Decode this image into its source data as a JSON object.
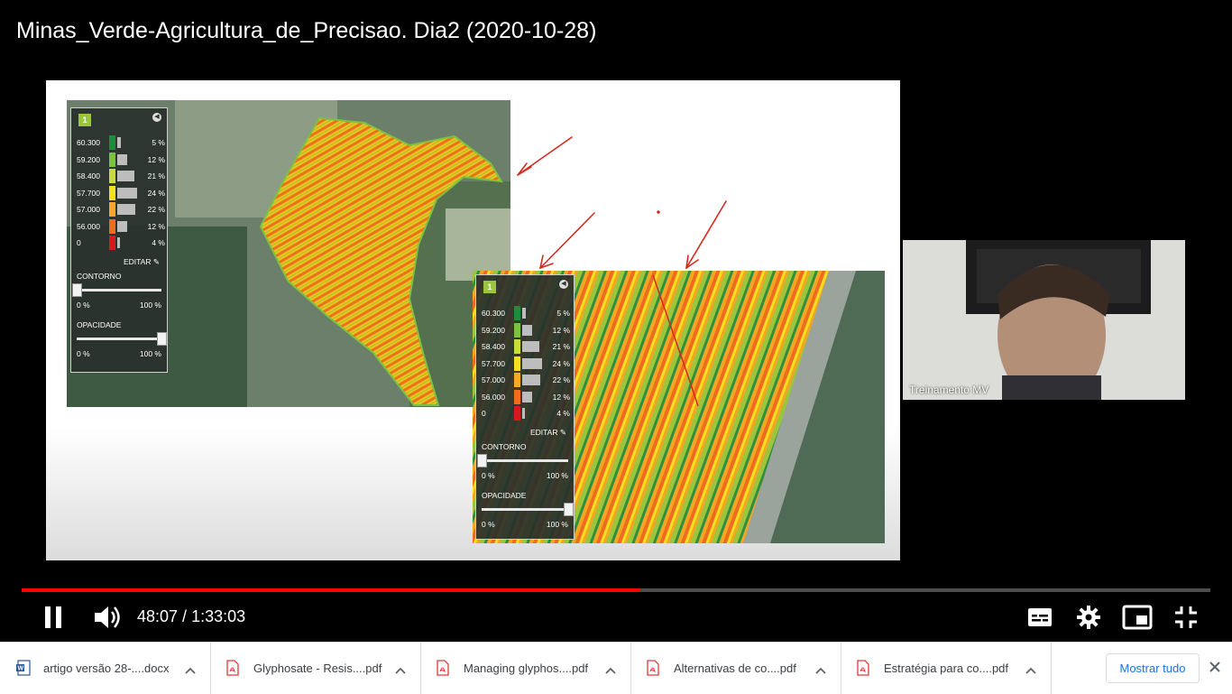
{
  "video": {
    "title": "Minas_Verde-Agricultura_de_Precisao. Dia2 (2020-10-28)",
    "current_time": "48:07",
    "separator": " / ",
    "duration": "1:33:03",
    "progress": 0.5205,
    "progress_color": "#ff0000"
  },
  "webcam": {
    "label": "Treinamento MV"
  },
  "legend": {
    "badge": "1",
    "rows": [
      {
        "label": "60.300",
        "pct": "5 %",
        "color": "#1e8c3a",
        "bar": 0.2
      },
      {
        "label": "59.200",
        "pct": "12 %",
        "color": "#7cc241",
        "bar": 0.5
      },
      {
        "label": "58.400",
        "pct": "21 %",
        "color": "#c9dd3a",
        "bar": 0.85
      },
      {
        "label": "57.700",
        "pct": "24 %",
        "color": "#f4e01e",
        "bar": 1.0
      },
      {
        "label": "57.000",
        "pct": "22 %",
        "color": "#f7a825",
        "bar": 0.9
      },
      {
        "label": "56.000",
        "pct": "12 %",
        "color": "#ef6b1f",
        "bar": 0.5
      },
      {
        "label": "0",
        "pct": "4 %",
        "color": "#d7191c",
        "bar": 0.15
      }
    ],
    "edit": "EDITAR",
    "contorno": "CONTORNO",
    "opacidade": "OPACIDADE",
    "min": "0 %",
    "max": "100 %",
    "contorno_level": 0.0,
    "opacidade_level": 1.0
  },
  "downloads": {
    "items": [
      {
        "name": "artigo versão 28-....docx",
        "type": "word-icon"
      },
      {
        "name": "Glyphosate - Resis....pdf",
        "type": "pdf-icon"
      },
      {
        "name": "Managing glyphos....pdf",
        "type": "pdf-icon"
      },
      {
        "name": "Alternativas de co....pdf",
        "type": "pdf-icon"
      },
      {
        "name": "Estratégia para co....pdf",
        "type": "pdf-icon"
      }
    ],
    "show_all": "Mostrar tudo"
  },
  "colors": {
    "word": "#2b579a",
    "pdf": "#e53935",
    "link": "#1a73e8"
  }
}
